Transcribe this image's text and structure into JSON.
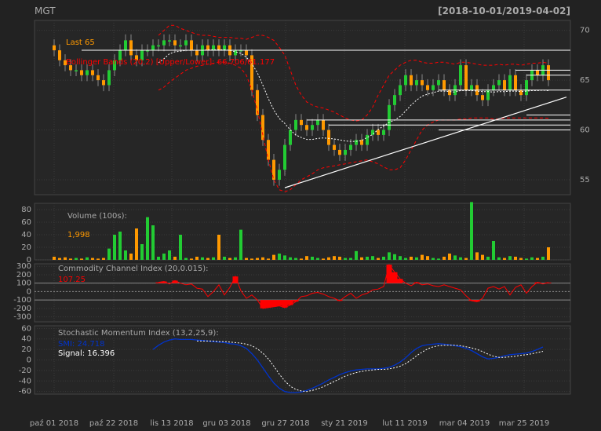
{
  "header": {
    "symbol": "MGT",
    "range": "[2018-10-01/2019-04-02]"
  },
  "colors": {
    "bg": "#222222",
    "panel": "#262626",
    "grid": "#3a3a3a",
    "up": "#22cc33",
    "down": "#ff9900",
    "red": "#ff0000",
    "text": "#aaaaaa",
    "blue": "#0033cc"
  },
  "chart_data": {
    "type": "line",
    "x": [
      "2018-10-01",
      "2018-10-22",
      "2018-11-13",
      "2018-12-03",
      "2018-12-27",
      "2019-01-21",
      "2019-02-11",
      "2019-03-04",
      "2019-03-25"
    ],
    "x_tick_labels": [
      "paź 01 2018",
      "paź 22 2018",
      "lis 13 2018",
      "gru 03 2018",
      "gru 27 2018",
      "sty 21 2019",
      "lut 11 2019",
      "mar 04 2019",
      "mar 25 2019"
    ],
    "price_panel": {
      "last_label": "Last 65",
      "bbands_label": "Bollinger Bands (20,2) [Upper/Lower]: 66.706/61.177",
      "ylim": [
        53.5,
        71
      ],
      "yticks": [
        55,
        60,
        65,
        70
      ],
      "closes": [
        68,
        67,
        66.5,
        66,
        66,
        65.5,
        66,
        65.5,
        65,
        64.5,
        66,
        67,
        68,
        69,
        67.5,
        67,
        68,
        68,
        68.5,
        68.5,
        69,
        69,
        68.5,
        68.5,
        69,
        68,
        67.5,
        68.5,
        68,
        68.5,
        68,
        68.5,
        67.5,
        68,
        68,
        67.5,
        64,
        61.5,
        59,
        57,
        55,
        56,
        58.5,
        60,
        61,
        60.5,
        60,
        60.5,
        61,
        60,
        58.5,
        58,
        57.5,
        58,
        58.5,
        59,
        58.5,
        59.5,
        60,
        59.5,
        60,
        62.5,
        63.5,
        64.5,
        65.5,
        64.5,
        65,
        64.5,
        64,
        64.5,
        65,
        64,
        63.5,
        64.5,
        66.5,
        64,
        64.5,
        63.5,
        63,
        64,
        64.5,
        65,
        64,
        65.5,
        64,
        63.5,
        65,
        66,
        65.5,
        66.5,
        65
      ],
      "bb_upper": [
        null,
        null,
        null,
        null,
        null,
        null,
        null,
        null,
        null,
        null,
        null,
        null,
        null,
        null,
        null,
        null,
        null,
        null,
        null,
        69.5,
        70,
        70.5,
        70.5,
        70.2,
        70,
        69.8,
        69.6,
        69.5,
        69.5,
        69.4,
        69.3,
        69.3,
        69.3,
        69.2,
        69.2,
        69.1,
        69.3,
        69.5,
        69.5,
        69.3,
        69,
        68.3,
        67.5,
        66,
        64.5,
        63.5,
        62.8,
        62.5,
        62.3,
        62.2,
        62,
        61.8,
        61.5,
        61.2,
        61,
        60.9,
        61,
        61.5,
        62.3,
        63.5,
        64.5,
        65.5,
        66,
        66.5,
        66.8,
        67,
        67,
        66.8,
        66.7,
        66.7,
        66.8,
        66.8,
        66.7,
        66.6,
        66.8,
        66.8,
        66.7,
        66.6,
        66.5,
        66.5,
        66.5,
        66.6,
        66.5,
        66.6,
        66.6,
        66.5,
        66.6,
        66.7,
        66.7,
        66.8,
        66.706
      ],
      "bb_lower": [
        null,
        null,
        null,
        null,
        null,
        null,
        null,
        null,
        null,
        null,
        null,
        null,
        null,
        null,
        null,
        null,
        null,
        null,
        null,
        64,
        64.3,
        64.8,
        65.2,
        65.6,
        66,
        66.2,
        66.4,
        66.5,
        66.6,
        66.7,
        66.8,
        66.8,
        66.7,
        66.5,
        66.2,
        65.5,
        64,
        62,
        59.5,
        57,
        55,
        54,
        53.8,
        54,
        54.5,
        55,
        55.3,
        55.6,
        56,
        56.2,
        56.3,
        56.4,
        56.5,
        56.6,
        56.7,
        56.8,
        56.9,
        57,
        56.8,
        56.6,
        56.3,
        56,
        56,
        56.2,
        57,
        58,
        59,
        60,
        60.5,
        60.8,
        61,
        61,
        61,
        61,
        61.1,
        61.1,
        61.2,
        61.2,
        61.2,
        61.2,
        61.1,
        61.1,
        61.2,
        61.2,
        61.2,
        61.2,
        61.2,
        61.2,
        61.2,
        61.2,
        61.177
      ]
    },
    "volume_panel": {
      "title": "Volume (100s):",
      "last_label": "1,998",
      "ylim": [
        0,
        90
      ],
      "yticks": [
        0,
        20,
        40,
        60,
        80
      ],
      "values": [
        5,
        3,
        4,
        2,
        3,
        2,
        4,
        3,
        2,
        3,
        18,
        40,
        45,
        15,
        10,
        50,
        25,
        68,
        55,
        5,
        10,
        15,
        5,
        40,
        3,
        2,
        5,
        4,
        3,
        4,
        40,
        5,
        3,
        4,
        48,
        3,
        2,
        3,
        4,
        2,
        8,
        10,
        7,
        4,
        3,
        2,
        6,
        5,
        3,
        2,
        4,
        6,
        5,
        3,
        3,
        14,
        4,
        5,
        6,
        3,
        5,
        12,
        9,
        6,
        3,
        5,
        4,
        8,
        6,
        3,
        2,
        5,
        10,
        7,
        4,
        3,
        92,
        12,
        8,
        5,
        30,
        4,
        3,
        6,
        5,
        3,
        2,
        4,
        3,
        5,
        20
      ]
    },
    "cci_panel": {
      "title": "Commodity Channel Index (20,0.015):",
      "last_label": "107.25",
      "ylim": [
        -360,
        330
      ],
      "yticks": [
        300,
        200,
        100,
        0,
        -100,
        -200,
        -300
      ],
      "values": [
        null,
        null,
        null,
        null,
        null,
        null,
        null,
        null,
        null,
        null,
        null,
        null,
        null,
        null,
        null,
        null,
        null,
        null,
        null,
        110,
        120,
        90,
        130,
        100,
        80,
        90,
        40,
        30,
        -60,
        0,
        80,
        -40,
        50,
        180,
        10,
        -80,
        -40,
        -100,
        -200,
        -190,
        -180,
        -170,
        -190,
        -160,
        -120,
        -60,
        -50,
        -20,
        -10,
        -30,
        -60,
        -80,
        -110,
        -60,
        -20,
        -80,
        -40,
        -20,
        20,
        30,
        60,
        320,
        230,
        150,
        100,
        70,
        110,
        80,
        90,
        70,
        60,
        80,
        60,
        40,
        20,
        -50,
        -110,
        -120,
        -80,
        40,
        60,
        30,
        60,
        -40,
        50,
        80,
        -20,
        60,
        110,
        90,
        107.25
      ]
    },
    "smi_panel": {
      "title": "Stochastic Momentum Index (13,2,25,9):",
      "smi_label": "SMI: 24.718",
      "signal_label": "Signal: 16.396",
      "ylim": [
        -65,
        65
      ],
      "yticks": [
        60,
        40,
        20,
        0,
        -20,
        -40,
        -60
      ],
      "smi": [
        null,
        null,
        null,
        null,
        null,
        null,
        null,
        null,
        null,
        null,
        null,
        null,
        null,
        null,
        null,
        null,
        null,
        null,
        20,
        28,
        34,
        38,
        40,
        39,
        39,
        39,
        38,
        37,
        36,
        35,
        34,
        33,
        31,
        30,
        27,
        22,
        12,
        0,
        -15,
        -30,
        -44,
        -54,
        -60,
        -62,
        -62,
        -61,
        -58,
        -54,
        -49,
        -44,
        -38,
        -33,
        -28,
        -24,
        -21,
        -19,
        -18,
        -17,
        -17,
        -17,
        -16,
        -14,
        -10,
        -4,
        4,
        14,
        22,
        27,
        29,
        30,
        31,
        30,
        29,
        27,
        25,
        22,
        18,
        12,
        6,
        2,
        3,
        5,
        8,
        10,
        11,
        12,
        13,
        16,
        20,
        24.718
      ],
      "signal": [
        null,
        null,
        null,
        null,
        null,
        null,
        null,
        null,
        null,
        null,
        null,
        null,
        null,
        null,
        null,
        null,
        null,
        null,
        null,
        null,
        null,
        null,
        null,
        null,
        null,
        null,
        36,
        36,
        36,
        36,
        35,
        35,
        34,
        33,
        32,
        30,
        27,
        21,
        13,
        2,
        -12,
        -27,
        -40,
        -50,
        -56,
        -59,
        -60,
        -58,
        -55,
        -51,
        -46,
        -41,
        -36,
        -31,
        -27,
        -24,
        -22,
        -20,
        -19,
        -18,
        -18,
        -17,
        -15,
        -12,
        -7,
        0,
        8,
        15,
        21,
        25,
        27,
        28,
        28,
        28,
        27,
        25,
        23,
        20,
        16,
        11,
        7,
        5,
        5,
        6,
        7,
        9,
        10,
        12,
        14,
        16.396
      ]
    }
  }
}
